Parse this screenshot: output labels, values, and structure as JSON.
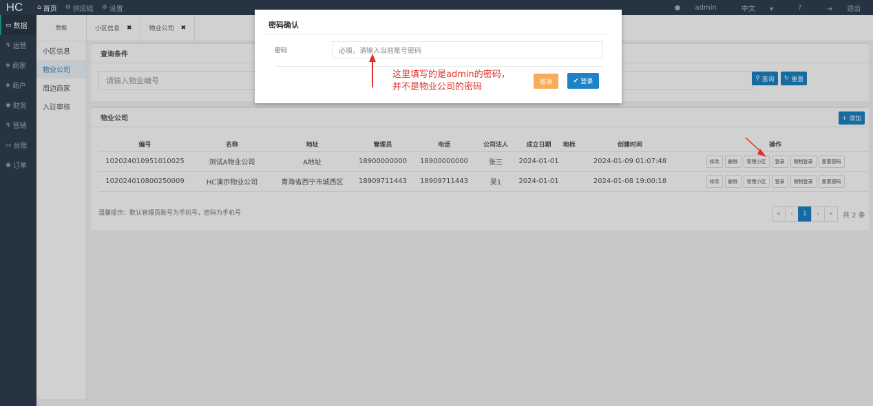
{
  "topbar": {
    "logo": "HC",
    "nav": [
      {
        "label": "首页",
        "icon": "home-icon"
      },
      {
        "label": "供应链",
        "icon": "gear-icon"
      },
      {
        "label": "设置",
        "icon": "gear-icon"
      }
    ],
    "user": "admin",
    "language": "中文",
    "help": "?",
    "logout": "退出"
  },
  "sidebar": {
    "items": [
      {
        "label": "数据",
        "icon": "monitor-icon"
      },
      {
        "label": "运营",
        "icon": "bolt-icon"
      },
      {
        "label": "商家",
        "icon": "shop-icon"
      },
      {
        "label": "商户",
        "icon": "shop-icon"
      },
      {
        "label": "财务",
        "icon": "globe-icon"
      },
      {
        "label": "营销",
        "icon": "bolt-icon"
      },
      {
        "label": "台账",
        "icon": "monitor-icon"
      },
      {
        "label": "订单",
        "icon": "globe-icon"
      }
    ]
  },
  "submenu": {
    "header": "数据",
    "items": [
      "小区信息",
      "物业公司",
      "周边商家",
      "入驻审核"
    ]
  },
  "tabs": [
    {
      "label": "小区信息"
    },
    {
      "label": "物业公司"
    }
  ],
  "query": {
    "title": "查询条件",
    "placeholder": "请输入物业编号",
    "search_label": "查询",
    "reset_label": "重置"
  },
  "company": {
    "title": "物业公司",
    "add_label": "添加",
    "columns": [
      "编号",
      "名称",
      "地址",
      "管理员",
      "电话",
      "公司法人",
      "成立日期",
      "地标",
      "创建时间",
      "操作"
    ],
    "rows": [
      {
        "id": "102024010951010025",
        "name": "测试A物业公司",
        "address": "A地址",
        "admin": "18900000000",
        "phone": "18900000000",
        "legal": "张三",
        "founded": "2024-01-01",
        "landmark": "",
        "created": "2024-01-09 01:07:48"
      },
      {
        "id": "102024010800250009",
        "name": "HC演示物业公司",
        "address": "青海省西宁市城西区",
        "admin": "18909711443",
        "phone": "18909711443",
        "legal": "吴1",
        "founded": "2024-01-01",
        "landmark": "",
        "created": "2024-01-08 19:00:18"
      }
    ],
    "ops": [
      "修改",
      "删除",
      "管理小区",
      "登录",
      "限制登录",
      "重置密码"
    ],
    "tip": "温馨提示：默认管理员账号为手机号，密码为手机号",
    "pager": {
      "first": "«",
      "prev": "‹",
      "current": "1",
      "next": "›",
      "last": "»",
      "total": "共 2 条"
    }
  },
  "modal": {
    "title": "密码确认",
    "label": "密码",
    "placeholder": "必填，请输入当前账号密码",
    "cancel_label": "取消",
    "login_label": "登录"
  },
  "annotation": {
    "line1": "这里填写的是admin的密码，",
    "line2": "并不是物业公司的密码",
    "color": "#e0302a"
  }
}
